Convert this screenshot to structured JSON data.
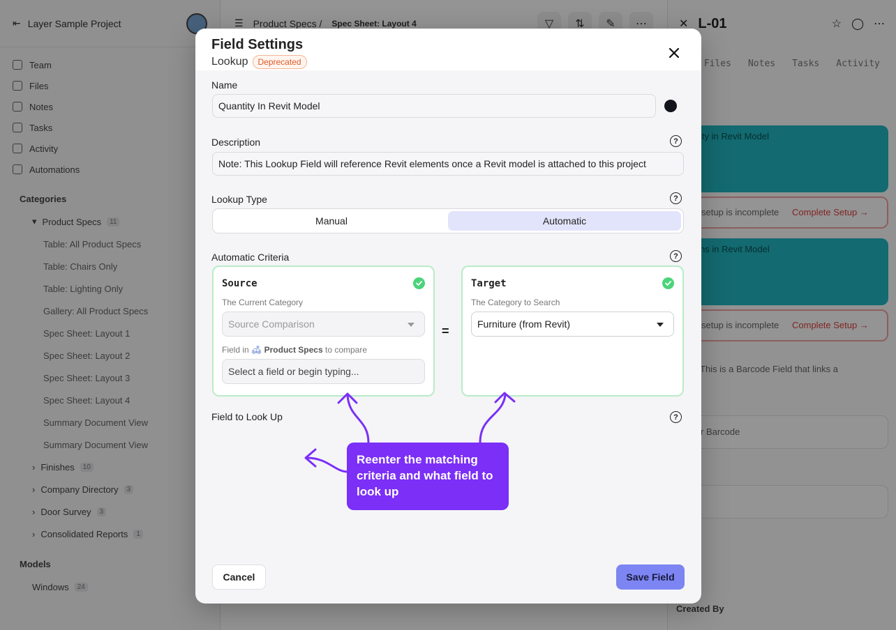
{
  "background": {
    "project_name": "Layer Sample Project",
    "nav_items": [
      "Team",
      "Files",
      "Notes",
      "Tasks",
      "Activity",
      "Automations"
    ],
    "categories_label": "Categories",
    "product_specs": {
      "name": "Product Specs",
      "count": "11"
    },
    "views": [
      "Table: All Product Specs",
      "Table: Chairs Only",
      "Table: Lighting Only",
      "Gallery: All Product Specs",
      "Spec Sheet: Layout 1",
      "Spec Sheet: Layout 2",
      "Spec Sheet: Layout 3",
      "Spec Sheet: Layout 4",
      "Summary Document View",
      "Summary Document View"
    ],
    "other_categories": [
      {
        "name": "Finishes",
        "count": "10"
      },
      {
        "name": "Company Directory",
        "count": "3"
      },
      {
        "name": "Door Survey",
        "count": "3"
      },
      {
        "name": "Consolidated Reports",
        "count": "1"
      }
    ],
    "models_label": "Models",
    "models_item": {
      "name": "Windows",
      "count": "24"
    },
    "breadcrumb": {
      "parent": "Product Specs /",
      "current": "Spec Sheet: Layout 4"
    },
    "detail": {
      "title": "L-01",
      "tabs": [
        "s",
        "Files",
        "Notes",
        "Tasks",
        "Activity"
      ],
      "card1_title": "ity in Revit Model",
      "setup_text": "setup is incomplete",
      "complete_setup": "Complete Setup →",
      "card2_title": "ns in Revit Model",
      "barcode_text": "This is a Barcode Field that links a",
      "barcode_placeholder": "r Barcode",
      "created_by": "Created By"
    }
  },
  "modal": {
    "title": "Field Settings",
    "subtitle": "Lookup",
    "badge": "Deprecated",
    "name_label": "Name",
    "name_value": "Quantity In Revit Model",
    "field_color": "#14141c",
    "description_label": "Description",
    "description_value": "Note: This Lookup Field will reference Revit elements once a Revit model is attached to this project",
    "lookup_type_label": "Lookup Type",
    "lookup_options": [
      "Manual",
      "Automatic"
    ],
    "lookup_selected": "Automatic",
    "automatic_criteria_label": "Automatic Criteria",
    "source": {
      "title": "Source",
      "subtitle": "The Current Category",
      "select_value": "Source Comparison",
      "field_in_prefix": "Field in",
      "field_in_category": "Product Specs",
      "field_in_suffix": "to compare",
      "field_placeholder": "Select a field or begin typing..."
    },
    "equals_sign": "=",
    "target": {
      "title": "Target",
      "subtitle": "The Category to Search",
      "select_value": "Furniture (from Revit)"
    },
    "field_to_look_up_label": "Field to Look Up",
    "callout_text": "Reenter the matching criteria and what field to look up",
    "cancel_label": "Cancel",
    "save_label": "Save Field",
    "colors": {
      "accent": "#7c85f2",
      "callout": "#7b2ff7",
      "valid_border": "#b8ecc8",
      "check": "#4cd47a",
      "deprecated": "#e05a2a"
    }
  }
}
